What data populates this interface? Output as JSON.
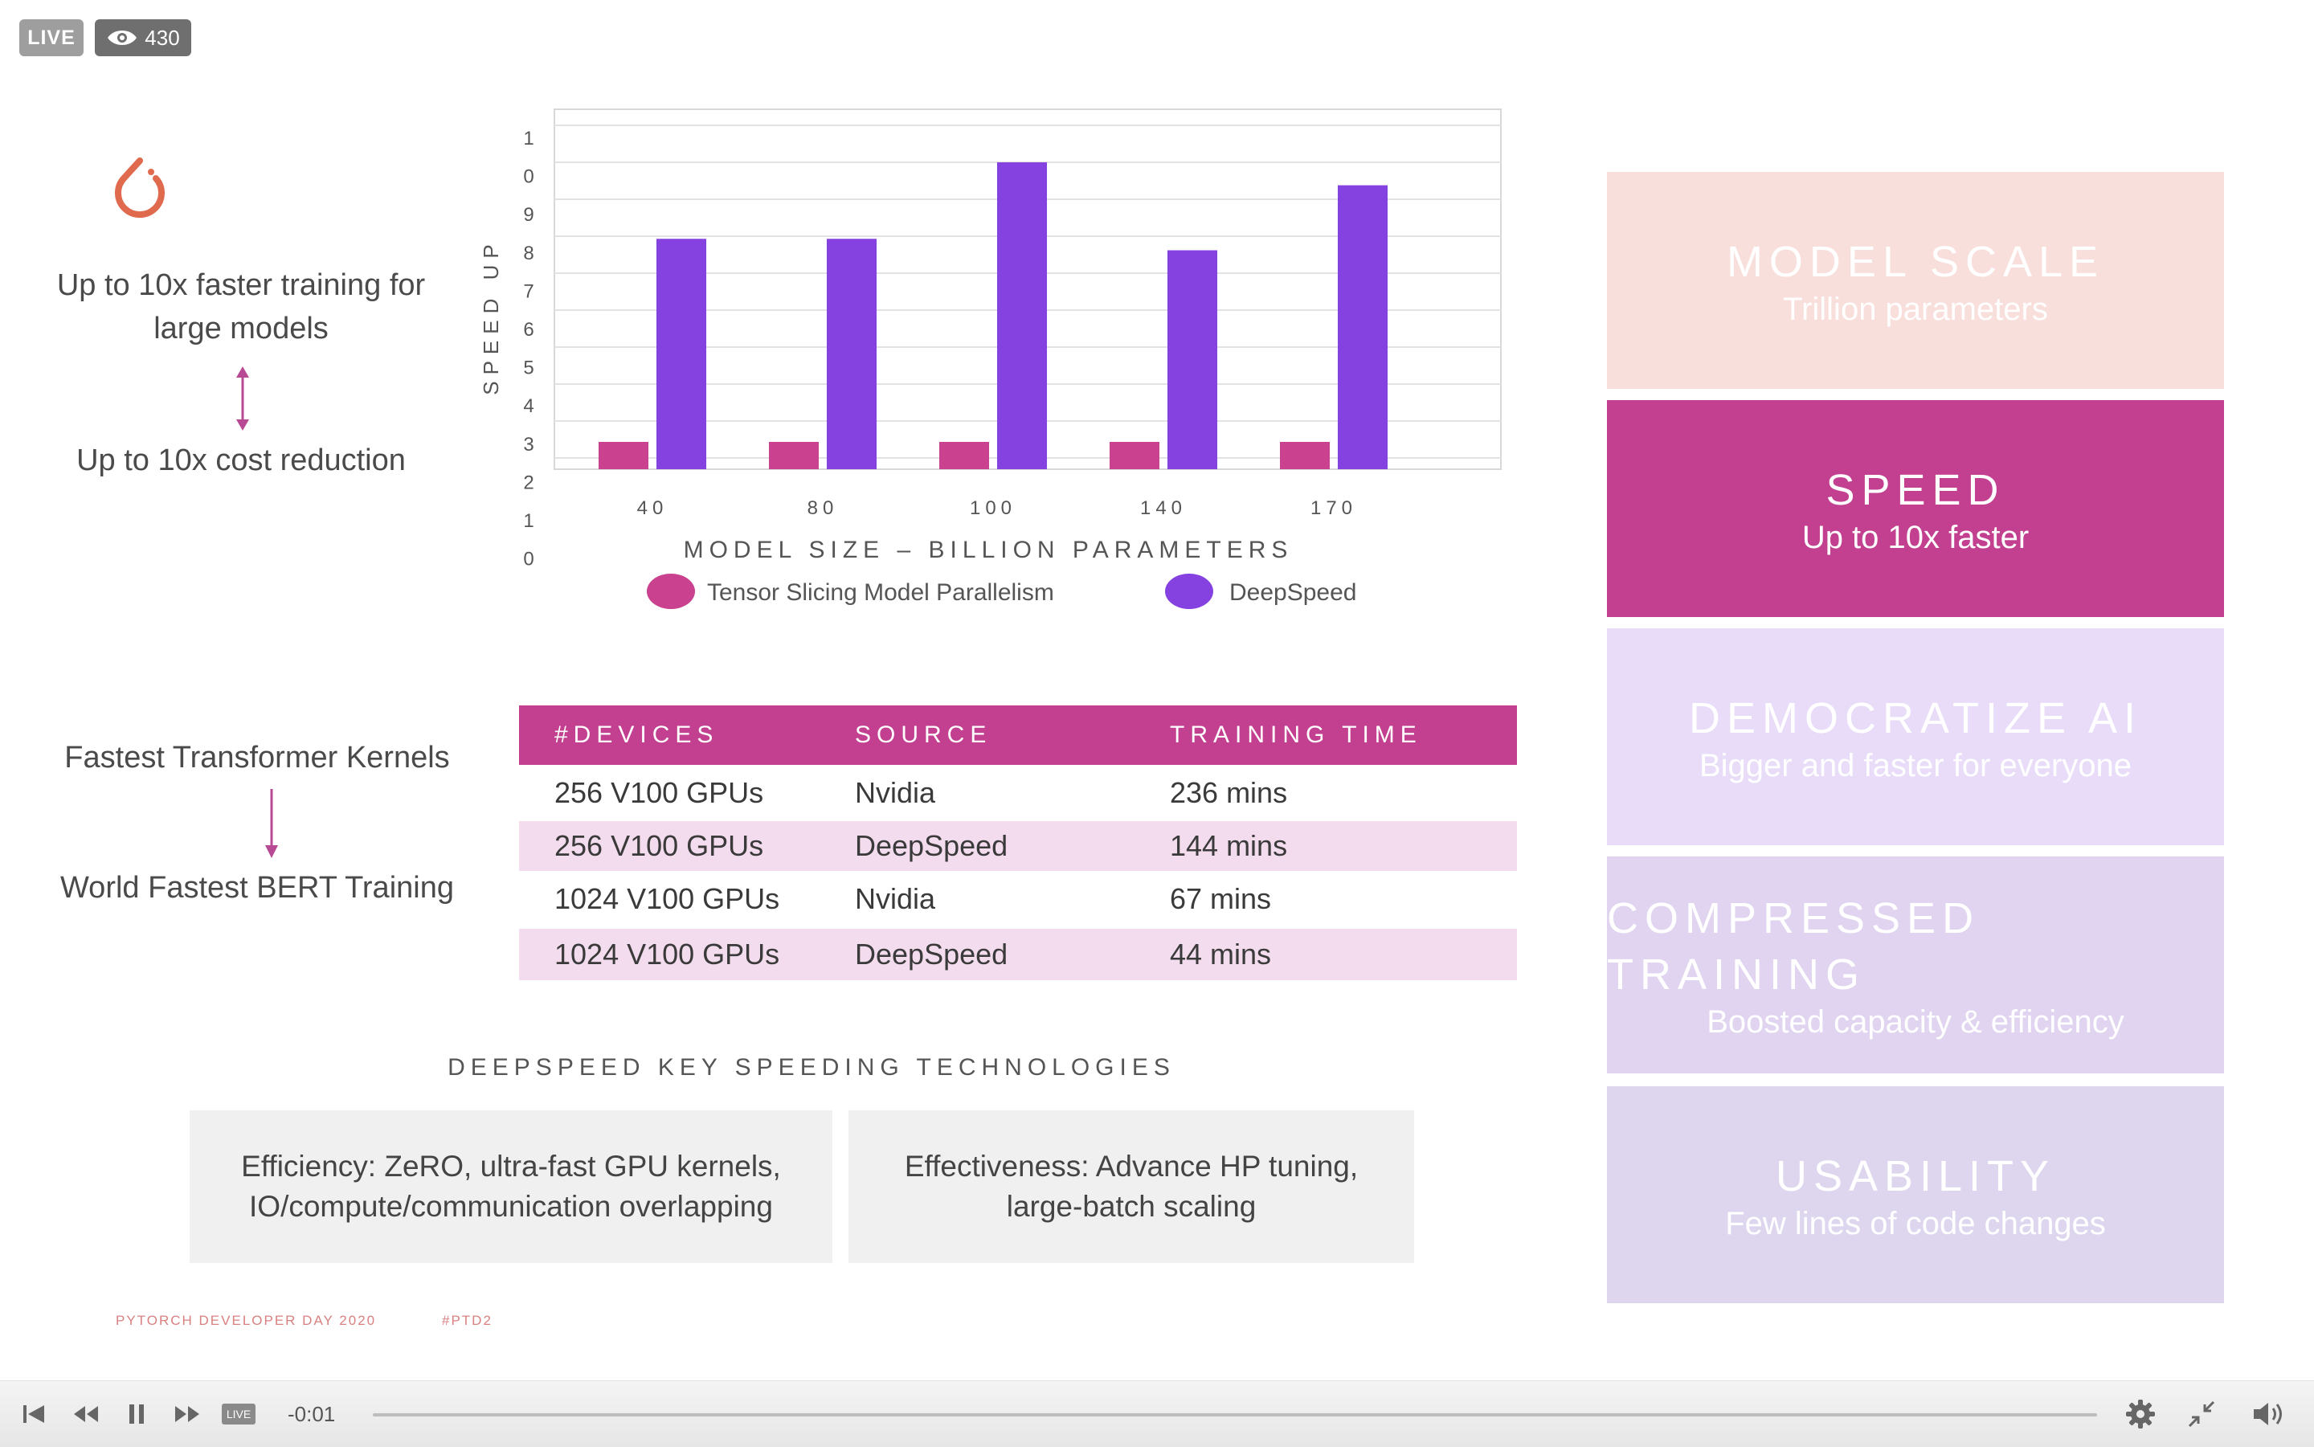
{
  "live_badge": "LIVE",
  "viewers": "430",
  "left_statements": {
    "speed_line1": "Up to 10x faster training for",
    "speed_line2": "large models",
    "cost": "Up to 10x cost reduction",
    "kernels": "Fastest Transformer Kernels",
    "bert": "World Fastest BERT Training"
  },
  "chart_data": {
    "type": "bar",
    "xlabel": "MODEL SIZE – BILLION PARAMETERS",
    "ylabel": "SPEED UP",
    "categories": [
      "40",
      "80",
      "100",
      "140",
      "170"
    ],
    "y_tick_labels": [
      "0",
      "1",
      "2",
      "3",
      "4",
      "5",
      "6",
      "7",
      "8",
      "9",
      "0",
      "1"
    ],
    "series": [
      {
        "name": "Tensor Slicing Model Parallelism",
        "color": "#c9418f",
        "values": [
          1,
          1,
          1,
          1,
          1
        ]
      },
      {
        "name": "DeepSpeed",
        "color": "#8542e0",
        "values": [
          6.1,
          6.1,
          8.1,
          5.8,
          7.5
        ]
      }
    ],
    "ylim": [
      0,
      11
    ],
    "grid": true,
    "legend_position": "bottom"
  },
  "table": {
    "headers": [
      "#DEVICES",
      "SOURCE",
      "TRAINING TIME"
    ],
    "rows": [
      [
        "256 V100 GPUs",
        "Nvidia",
        "236 mins"
      ],
      [
        "256 V100 GPUs",
        "DeepSpeed",
        "144 mins"
      ],
      [
        "1024 V100 GPUs",
        "Nvidia",
        "67 mins"
      ],
      [
        "1024 V100 GPUs",
        "DeepSpeed",
        "44 mins"
      ]
    ]
  },
  "technologies": {
    "title": "DEEPSPEED KEY SPEEDING TECHNOLOGIES",
    "efficiency_line1": "Efficiency: ZeRO, ultra-fast GPU kernels,",
    "efficiency_line2": "IO/compute/communication overlapping",
    "effectiveness_line1": "Effectiveness: Advance HP tuning,",
    "effectiveness_line2": "large-batch scaling"
  },
  "footer": {
    "event": "PYTORCH DEVELOPER DAY 2020",
    "hashtag": "#PTD2"
  },
  "panels": [
    {
      "title": "MODEL SCALE",
      "subtitle": "Trillion parameters",
      "color": "#f8dfdb"
    },
    {
      "title": "SPEED",
      "subtitle": "Up to 10x faster",
      "color": "#c2408f"
    },
    {
      "title": "DEMOCRATIZE AI",
      "subtitle": "Bigger and faster for everyone",
      "color": "#e8dcf8"
    },
    {
      "title": "COMPRESSED TRAINING",
      "subtitle": "Boosted capacity & efficiency",
      "color": "#e0d4f0"
    },
    {
      "title": "USABILITY",
      "subtitle": "Few lines of code changes",
      "color": "#ddd6ee"
    }
  ],
  "player": {
    "live_pill": "LIVE",
    "time": "-0:01"
  },
  "colors": {
    "brand_magenta": "#c2408f",
    "brand_purple": "#8542e0",
    "arrow": "#b84a94"
  },
  "icons": [
    "pytorch-logo",
    "eye-icon",
    "skip-back-icon",
    "rewind-icon",
    "pause-icon",
    "fast-forward-icon",
    "gear-icon",
    "exit-fullscreen-icon",
    "volume-icon"
  ]
}
